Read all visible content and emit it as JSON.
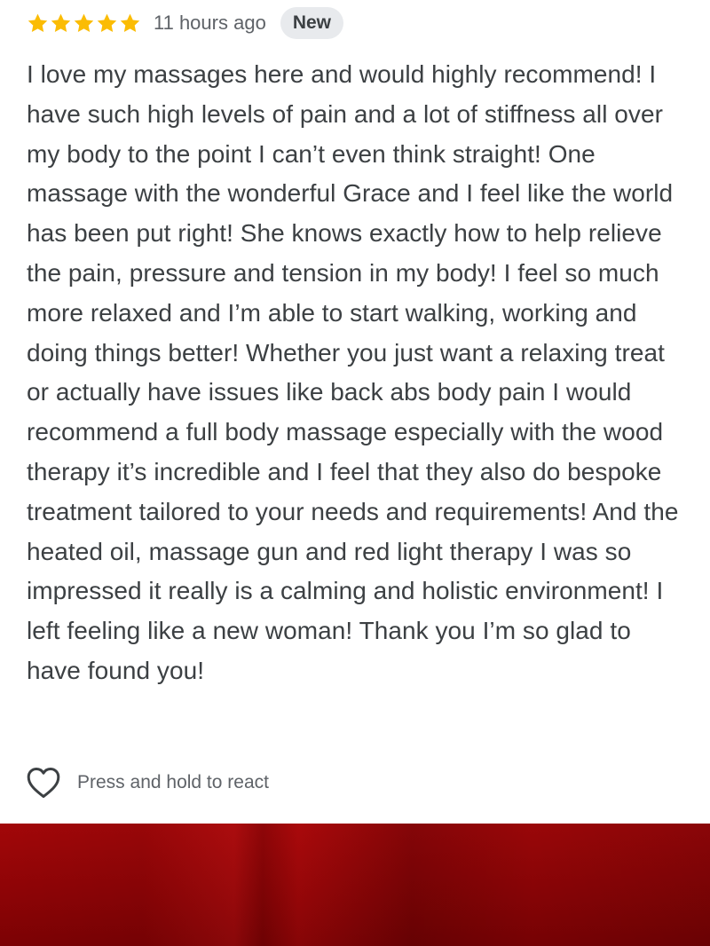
{
  "review": {
    "rating": 5,
    "rating_max": 5,
    "star_color": "#fbbc04",
    "time_ago": "11 hours ago",
    "badge": "New",
    "text": "I love my massages here and would highly recommend! I have such high levels of pain and a lot of stiffness all over my body to the point I can’t even think straight! One massage with the wonderful Grace and I feel like the world has been put right! She knows exactly how to help relieve the pain, pressure and tension in my body! I feel so much more relaxed and I’m able to start walking, working and doing things better! Whether you just want a relaxing treat or actually have issues like back abs body pain I would recommend a full body massage especially with the wood therapy it’s incredible and I feel that they also do bespoke treatment tailored to your needs and requirements! And the heated oil, massage gun and red light therapy I was so impressed it really is a calming and holistic environment! I left feeling like a new woman! Thank you I’m so glad to have found you!"
  },
  "reaction": {
    "icon": "heart-outline-icon",
    "label": "Press and hold to react"
  },
  "media_panel": {
    "color": "#9a0507"
  }
}
